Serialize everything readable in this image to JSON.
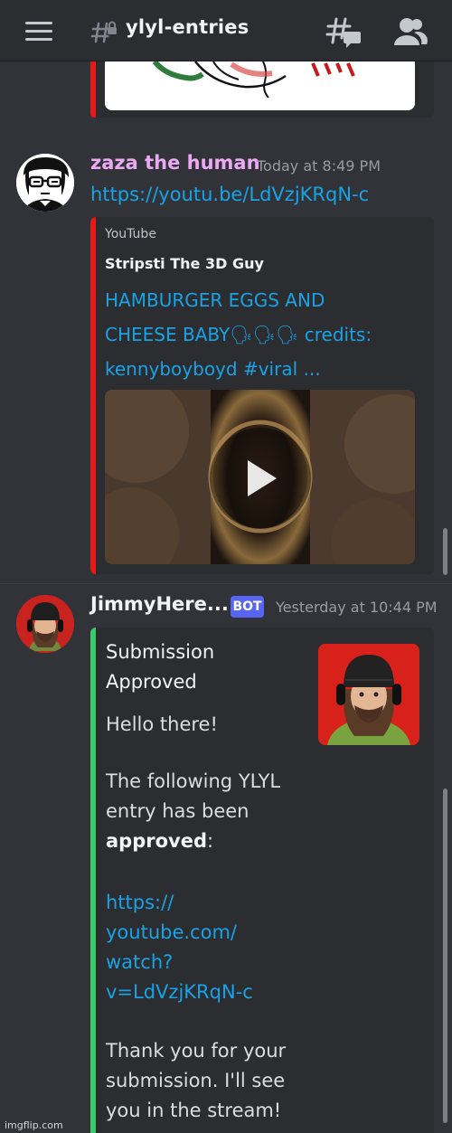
{
  "header": {
    "channel_name": "ylyl-entries",
    "icons": [
      "hamburger-menu-icon",
      "locked-channel-hash-icon",
      "threads-icon",
      "members-icon"
    ]
  },
  "messages": [
    {
      "author": "zaza the human",
      "timestamp": "Today at 8:49 PM",
      "content_link": "https://youtu.be/LdVzjKRqN-c",
      "embed": {
        "provider": "YouTube",
        "author": "Stripsti The 3D Guy",
        "title_lines": [
          "HAMBURGER EGGS AND",
          "CHEESE BABY🗣🗣🗣 credits:",
          "kennyboyboyd #viral ..."
        ],
        "accent_color": "#e31a1a",
        "thumbnail_icon": "play-icon"
      }
    },
    {
      "author": "JimmyHere...",
      "badge": "BOT",
      "timestamp": "Yesterday at 10:44 PM",
      "embed": {
        "title_lines": [
          "Submission",
          "Approved"
        ],
        "greeting": "Hello there!",
        "line1": "The following YLYL",
        "line2_prefix": "entry has been",
        "bold_word": "approved",
        "after_bold": ":",
        "link_lines": [
          "https://",
          "youtube.com/",
          "watch?",
          "v=LdVzjKRqN-c"
        ],
        "thanks_lines": [
          "Thank you for your",
          "submission. I'll see",
          "you in the stream!"
        ],
        "accent_color": "#3ec86a"
      }
    }
  ],
  "watermark": "imgflip.com",
  "colors": {
    "background": "#313338",
    "header": "#2b2d31",
    "link": "#18a3e6",
    "username_pink": "#eba9f4",
    "bot_badge": "#5865f2"
  }
}
